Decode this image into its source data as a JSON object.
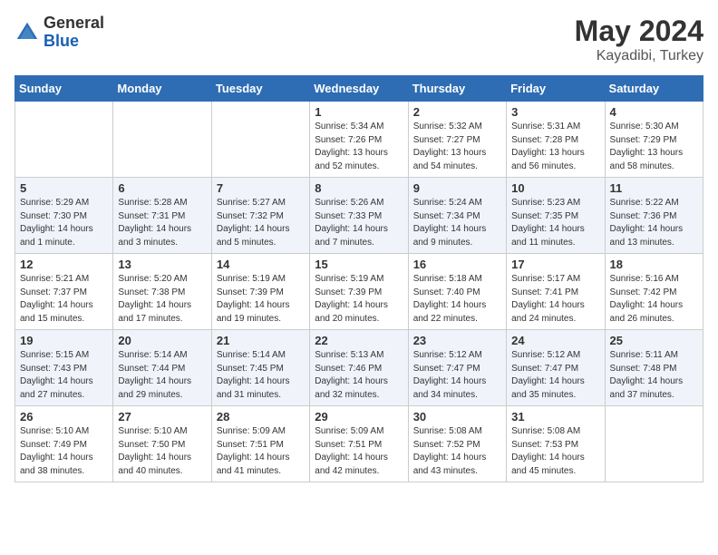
{
  "header": {
    "logo_general": "General",
    "logo_blue": "Blue",
    "title_month": "May 2024",
    "title_location": "Kayadibi, Turkey"
  },
  "weekdays": [
    "Sunday",
    "Monday",
    "Tuesday",
    "Wednesday",
    "Thursday",
    "Friday",
    "Saturday"
  ],
  "weeks": [
    [
      {
        "day": "",
        "sunrise": "",
        "sunset": "",
        "daylight": ""
      },
      {
        "day": "",
        "sunrise": "",
        "sunset": "",
        "daylight": ""
      },
      {
        "day": "",
        "sunrise": "",
        "sunset": "",
        "daylight": ""
      },
      {
        "day": "1",
        "sunrise": "Sunrise: 5:34 AM",
        "sunset": "Sunset: 7:26 PM",
        "daylight": "Daylight: 13 hours and 52 minutes."
      },
      {
        "day": "2",
        "sunrise": "Sunrise: 5:32 AM",
        "sunset": "Sunset: 7:27 PM",
        "daylight": "Daylight: 13 hours and 54 minutes."
      },
      {
        "day": "3",
        "sunrise": "Sunrise: 5:31 AM",
        "sunset": "Sunset: 7:28 PM",
        "daylight": "Daylight: 13 hours and 56 minutes."
      },
      {
        "day": "4",
        "sunrise": "Sunrise: 5:30 AM",
        "sunset": "Sunset: 7:29 PM",
        "daylight": "Daylight: 13 hours and 58 minutes."
      }
    ],
    [
      {
        "day": "5",
        "sunrise": "Sunrise: 5:29 AM",
        "sunset": "Sunset: 7:30 PM",
        "daylight": "Daylight: 14 hours and 1 minute."
      },
      {
        "day": "6",
        "sunrise": "Sunrise: 5:28 AM",
        "sunset": "Sunset: 7:31 PM",
        "daylight": "Daylight: 14 hours and 3 minutes."
      },
      {
        "day": "7",
        "sunrise": "Sunrise: 5:27 AM",
        "sunset": "Sunset: 7:32 PM",
        "daylight": "Daylight: 14 hours and 5 minutes."
      },
      {
        "day": "8",
        "sunrise": "Sunrise: 5:26 AM",
        "sunset": "Sunset: 7:33 PM",
        "daylight": "Daylight: 14 hours and 7 minutes."
      },
      {
        "day": "9",
        "sunrise": "Sunrise: 5:24 AM",
        "sunset": "Sunset: 7:34 PM",
        "daylight": "Daylight: 14 hours and 9 minutes."
      },
      {
        "day": "10",
        "sunrise": "Sunrise: 5:23 AM",
        "sunset": "Sunset: 7:35 PM",
        "daylight": "Daylight: 14 hours and 11 minutes."
      },
      {
        "day": "11",
        "sunrise": "Sunrise: 5:22 AM",
        "sunset": "Sunset: 7:36 PM",
        "daylight": "Daylight: 14 hours and 13 minutes."
      }
    ],
    [
      {
        "day": "12",
        "sunrise": "Sunrise: 5:21 AM",
        "sunset": "Sunset: 7:37 PM",
        "daylight": "Daylight: 14 hours and 15 minutes."
      },
      {
        "day": "13",
        "sunrise": "Sunrise: 5:20 AM",
        "sunset": "Sunset: 7:38 PM",
        "daylight": "Daylight: 14 hours and 17 minutes."
      },
      {
        "day": "14",
        "sunrise": "Sunrise: 5:19 AM",
        "sunset": "Sunset: 7:39 PM",
        "daylight": "Daylight: 14 hours and 19 minutes."
      },
      {
        "day": "15",
        "sunrise": "Sunrise: 5:19 AM",
        "sunset": "Sunset: 7:39 PM",
        "daylight": "Daylight: 14 hours and 20 minutes."
      },
      {
        "day": "16",
        "sunrise": "Sunrise: 5:18 AM",
        "sunset": "Sunset: 7:40 PM",
        "daylight": "Daylight: 14 hours and 22 minutes."
      },
      {
        "day": "17",
        "sunrise": "Sunrise: 5:17 AM",
        "sunset": "Sunset: 7:41 PM",
        "daylight": "Daylight: 14 hours and 24 minutes."
      },
      {
        "day": "18",
        "sunrise": "Sunrise: 5:16 AM",
        "sunset": "Sunset: 7:42 PM",
        "daylight": "Daylight: 14 hours and 26 minutes."
      }
    ],
    [
      {
        "day": "19",
        "sunrise": "Sunrise: 5:15 AM",
        "sunset": "Sunset: 7:43 PM",
        "daylight": "Daylight: 14 hours and 27 minutes."
      },
      {
        "day": "20",
        "sunrise": "Sunrise: 5:14 AM",
        "sunset": "Sunset: 7:44 PM",
        "daylight": "Daylight: 14 hours and 29 minutes."
      },
      {
        "day": "21",
        "sunrise": "Sunrise: 5:14 AM",
        "sunset": "Sunset: 7:45 PM",
        "daylight": "Daylight: 14 hours and 31 minutes."
      },
      {
        "day": "22",
        "sunrise": "Sunrise: 5:13 AM",
        "sunset": "Sunset: 7:46 PM",
        "daylight": "Daylight: 14 hours and 32 minutes."
      },
      {
        "day": "23",
        "sunrise": "Sunrise: 5:12 AM",
        "sunset": "Sunset: 7:47 PM",
        "daylight": "Daylight: 14 hours and 34 minutes."
      },
      {
        "day": "24",
        "sunrise": "Sunrise: 5:12 AM",
        "sunset": "Sunset: 7:47 PM",
        "daylight": "Daylight: 14 hours and 35 minutes."
      },
      {
        "day": "25",
        "sunrise": "Sunrise: 5:11 AM",
        "sunset": "Sunset: 7:48 PM",
        "daylight": "Daylight: 14 hours and 37 minutes."
      }
    ],
    [
      {
        "day": "26",
        "sunrise": "Sunrise: 5:10 AM",
        "sunset": "Sunset: 7:49 PM",
        "daylight": "Daylight: 14 hours and 38 minutes."
      },
      {
        "day": "27",
        "sunrise": "Sunrise: 5:10 AM",
        "sunset": "Sunset: 7:50 PM",
        "daylight": "Daylight: 14 hours and 40 minutes."
      },
      {
        "day": "28",
        "sunrise": "Sunrise: 5:09 AM",
        "sunset": "Sunset: 7:51 PM",
        "daylight": "Daylight: 14 hours and 41 minutes."
      },
      {
        "day": "29",
        "sunrise": "Sunrise: 5:09 AM",
        "sunset": "Sunset: 7:51 PM",
        "daylight": "Daylight: 14 hours and 42 minutes."
      },
      {
        "day": "30",
        "sunrise": "Sunrise: 5:08 AM",
        "sunset": "Sunset: 7:52 PM",
        "daylight": "Daylight: 14 hours and 43 minutes."
      },
      {
        "day": "31",
        "sunrise": "Sunrise: 5:08 AM",
        "sunset": "Sunset: 7:53 PM",
        "daylight": "Daylight: 14 hours and 45 minutes."
      },
      {
        "day": "",
        "sunrise": "",
        "sunset": "",
        "daylight": ""
      }
    ]
  ]
}
